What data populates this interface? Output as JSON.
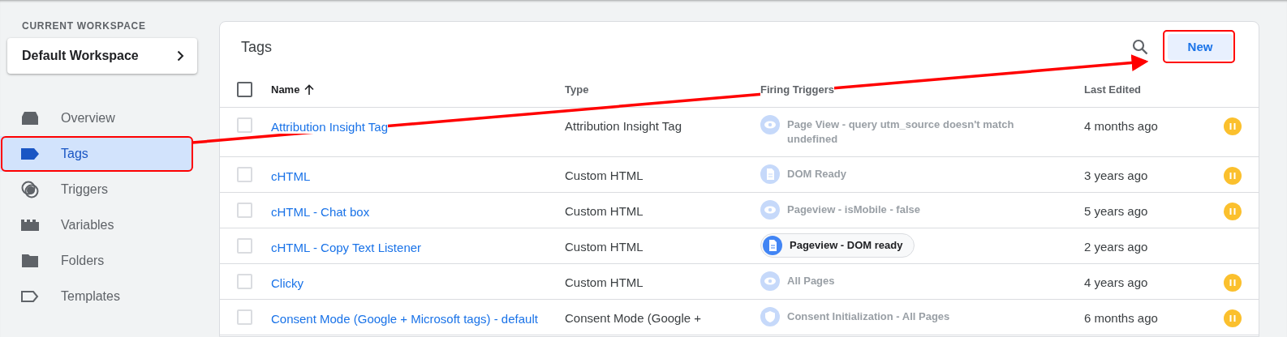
{
  "sidebar": {
    "workspace_label": "CURRENT WORKSPACE",
    "workspace": "Default Workspace",
    "items": [
      {
        "label": "Overview",
        "selected": false
      },
      {
        "label": "Tags",
        "selected": true
      },
      {
        "label": "Triggers",
        "selected": false
      },
      {
        "label": "Variables",
        "selected": false
      },
      {
        "label": "Folders",
        "selected": false
      },
      {
        "label": "Templates",
        "selected": false
      }
    ]
  },
  "panel": {
    "title": "Tags",
    "new_button": "New"
  },
  "table": {
    "columns": [
      "Name",
      "Type",
      "Firing Triggers",
      "Last Edited"
    ],
    "select_all_checked": false,
    "rows": [
      {
        "name": "Attribution Insight Tag",
        "type": "Attribution Insight Tag",
        "trigger": {
          "text": "Page View - query utm_source doesn't match undefined",
          "kind": "pageview",
          "active": false
        },
        "last_edited": "4 months ago",
        "paused": true,
        "checked": false
      },
      {
        "name": "cHTML",
        "type": "Custom HTML",
        "trigger": {
          "text": "DOM Ready",
          "kind": "dom",
          "active": false
        },
        "last_edited": "3 years ago",
        "paused": true,
        "checked": false
      },
      {
        "name": "cHTML - Chat box",
        "type": "Custom HTML",
        "trigger": {
          "text": "Pageview - isMobile - false",
          "kind": "pageview",
          "active": false
        },
        "last_edited": "5 years ago",
        "paused": true,
        "checked": false
      },
      {
        "name": "cHTML - Copy Text Listener",
        "type": "Custom HTML",
        "trigger": {
          "text": "Pageview - DOM ready",
          "kind": "dom",
          "active": true
        },
        "last_edited": "2 years ago",
        "paused": false,
        "checked": false
      },
      {
        "name": "Clicky",
        "type": "Custom HTML",
        "trigger": {
          "text": "All Pages",
          "kind": "pageview",
          "active": false
        },
        "last_edited": "4 years ago",
        "paused": true,
        "checked": false
      },
      {
        "name": "Consent Mode (Google + Microsoft tags) - default",
        "type": "Consent Mode (Google +",
        "trigger": {
          "text": "Consent Initialization - All Pages",
          "kind": "consent",
          "active": false
        },
        "last_edited": "6 months ago",
        "paused": true,
        "checked": false
      }
    ]
  }
}
